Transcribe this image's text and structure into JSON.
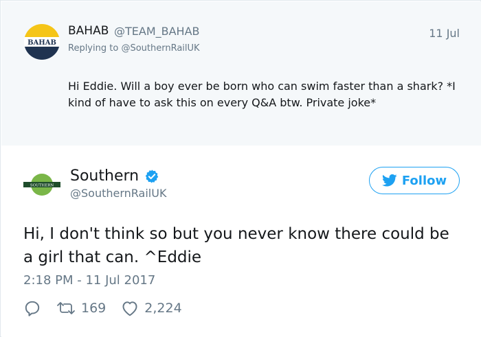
{
  "reply_tweet": {
    "author_name": "BAHAB",
    "author_handle": "@TEAM_BAHAB",
    "avatar_text": "BAHAB",
    "replying_to_label": "Replying to",
    "replying_to_handle": "@SouthernRailUK",
    "date": "11 Jul",
    "text": "Hi Eddie. Will a boy ever be born who can swim faster than a shark? *I kind of have to ask this on every Q&A btw. Private joke*"
  },
  "main_tweet": {
    "author_name": "Southern",
    "author_handle": "@SouthernRailUK",
    "avatar_text": "SOUTHERN",
    "verified": true,
    "follow_label": "Follow",
    "text": "Hi, I don't think so but you never know there could be a girl that can. ^Eddie",
    "timestamp": "2:18 PM - 11 Jul 2017",
    "retweets": "169",
    "likes": "2,224"
  },
  "colors": {
    "accent": "#1da1f2",
    "muted": "#657786",
    "reply_bg": "#f5f8fa",
    "bahab_yellow": "#f5c518",
    "bahab_navy": "#1f3350",
    "southern_green": "#7ab648",
    "southern_dark": "#1f4d2b"
  },
  "icons": {
    "verified": "verified-badge-icon",
    "follow": "twitter-bird-icon",
    "reply": "reply-icon",
    "retweet": "retweet-icon",
    "like": "heart-icon"
  }
}
